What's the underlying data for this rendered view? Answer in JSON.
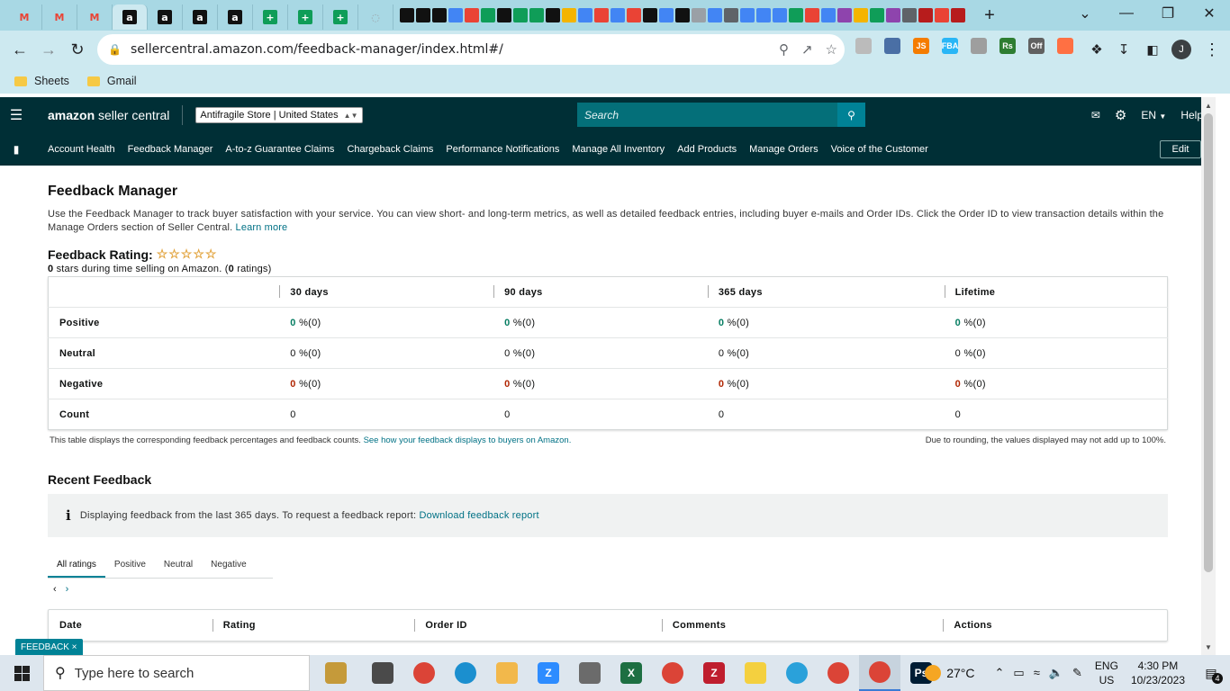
{
  "browser": {
    "tabs": [
      {
        "icon": "gmail-icon",
        "glyph": "M",
        "color": "#ea4335"
      },
      {
        "icon": "gmail-icon",
        "glyph": "M",
        "color": "#ea4335"
      },
      {
        "icon": "gmail-icon",
        "glyph": "M",
        "color": "#ea4335"
      },
      {
        "icon": "amazon-icon",
        "glyph": "a",
        "color": "#111111",
        "active": true
      },
      {
        "icon": "amazon-icon",
        "glyph": "a",
        "color": "#111111"
      },
      {
        "icon": "amazon-icon",
        "glyph": "a",
        "color": "#111111"
      },
      {
        "icon": "amazon-icon",
        "glyph": "a",
        "color": "#111111"
      },
      {
        "icon": "sheets-icon",
        "glyph": "+",
        "color": "#0f9d58"
      },
      {
        "icon": "sheets-icon",
        "glyph": "+",
        "color": "#0f9d58"
      },
      {
        "icon": "sheets-icon",
        "glyph": "+",
        "color": "#0f9d58"
      },
      {
        "icon": "loading-icon",
        "glyph": "◌",
        "color": "#9aa0a6"
      }
    ],
    "mini_tabs": [
      "#111111",
      "#111111",
      "#111111",
      "#4285f4",
      "#ea4335",
      "#0f9d58",
      "#111111",
      "#0f9d58",
      "#0f9d58",
      "#111111",
      "#f4b400",
      "#4285f4",
      "#ea4335",
      "#4285f4",
      "#ea4335",
      "#111111",
      "#4285f4",
      "#111111",
      "#9aa0a6",
      "#4285f4",
      "#5f6368",
      "#4285f4",
      "#4285f4",
      "#4285f4",
      "#0f9d58",
      "#ea4335",
      "#4285f4",
      "#8e44ad",
      "#f4b400",
      "#0f9d58",
      "#8e44ad",
      "#5f6368",
      "#b71c1c",
      "#ea4335",
      "#b71c1c"
    ],
    "new_tab": "+",
    "url": "sellercentral.amazon.com/feedback-manager/index.html#/",
    "profile_initial": "J",
    "extensions": [
      {
        "name": "extension-icon",
        "color": "#bbbbbb",
        "label": ""
      },
      {
        "name": "extension-icon",
        "color": "#4a6fa5",
        "label": ""
      },
      {
        "name": "js-extension-icon",
        "color": "#f57c00",
        "label": "JS"
      },
      {
        "name": "fba-extension-icon",
        "color": "#29b6f6",
        "label": "FBA"
      },
      {
        "name": "extension-icon",
        "color": "#9e9e9e",
        "label": ""
      },
      {
        "name": "rs-extension-icon",
        "color": "#2e7d32",
        "label": "Rs"
      },
      {
        "name": "off-extension-icon",
        "color": "#616161",
        "label": "Off"
      },
      {
        "name": "extension-icon",
        "color": "#ff7043",
        "label": ""
      }
    ],
    "bookmarks": [
      {
        "label": "Sheets"
      },
      {
        "label": "Gmail"
      }
    ]
  },
  "header": {
    "logo_strong": "amazon",
    "logo_rest": "seller central",
    "store": "Antifragile Store | United States",
    "search_placeholder": "Search",
    "language": "EN",
    "help": "Help"
  },
  "nav": {
    "items": [
      "Account Health",
      "Feedback Manager",
      "A-to-z Guarantee Claims",
      "Chargeback Claims",
      "Performance Notifications",
      "Manage All Inventory",
      "Add Products",
      "Manage Orders",
      "Voice of the Customer"
    ],
    "edit": "Edit"
  },
  "main": {
    "title": "Feedback Manager",
    "intro": "Use the Feedback Manager to track buyer satisfaction with your service. You can view short- and long-term metrics, as well as detailed feedback entries, including buyer e-mails and Order IDs. Click the Order ID to view transaction details within the Manage Orders section of Seller Central.",
    "learn_more": "Learn more",
    "rating_title": "Feedback Rating:",
    "stars": "☆☆☆☆☆",
    "rating_stars_value": 0,
    "rating_count": "0",
    "rating_sub_pre": "stars during time selling on Amazon. (",
    "rating_sub_post": "ratings)",
    "table": {
      "columns": [
        "30 days",
        "90 days",
        "365 days",
        "Lifetime"
      ],
      "rows": [
        {
          "label": "Positive",
          "tone": "green",
          "values": [
            [
              "0",
              "%(0)"
            ],
            [
              "0",
              "%(0)"
            ],
            [
              "0",
              "%(0)"
            ],
            [
              "0",
              "%(0)"
            ]
          ]
        },
        {
          "label": "Neutral",
          "tone": "neutral",
          "values": [
            [
              "0",
              "%(0)"
            ],
            [
              "0",
              "%(0)"
            ],
            [
              "0",
              "%(0)"
            ],
            [
              "0",
              "%(0)"
            ]
          ]
        },
        {
          "label": "Negative",
          "tone": "red",
          "values": [
            [
              "0",
              "%(0)"
            ],
            [
              "0",
              "%(0)"
            ],
            [
              "0",
              "%(0)"
            ],
            [
              "0",
              "%(0)"
            ]
          ]
        },
        {
          "label": "Count",
          "tone": "plain",
          "values": [
            [
              "0",
              ""
            ],
            [
              "0",
              ""
            ],
            [
              "0",
              ""
            ],
            [
              "0",
              ""
            ]
          ]
        }
      ]
    },
    "table_note": "This table displays the corresponding feedback percentages and feedback counts.",
    "table_note_link": "See how your feedback displays to buyers on Amazon.",
    "rounding_note": "Due to rounding, the values displayed may not add up to 100%.",
    "recent_title": "Recent Feedback",
    "info_icon": "i",
    "info_text": "Displaying feedback from the last 365 days. To request a feedback report:",
    "info_link": "Download feedback report",
    "filter_tabs": [
      "All ratings",
      "Positive",
      "Neutral",
      "Negative"
    ],
    "pager_prev": "‹",
    "pager_next": "›",
    "recent_columns": [
      "Date",
      "Rating",
      "Order ID",
      "Comments",
      "Actions"
    ]
  },
  "feedback_tag": "FEEDBACK ×",
  "taskbar": {
    "search_placeholder": "Type here to search",
    "apps": [
      {
        "name": "explorer-icon",
        "color": "#c59a3a",
        "glyph": "",
        "active": false
      },
      {
        "name": "task-view-icon",
        "color": "#4a4a4a",
        "glyph": "",
        "active": false
      },
      {
        "name": "chrome-icon",
        "color": "#db4437",
        "glyph": "",
        "active": false
      },
      {
        "name": "edge-icon",
        "color": "#1b8fcf",
        "glyph": "",
        "active": false
      },
      {
        "name": "file-explorer-icon",
        "color": "#f2b84b",
        "glyph": "",
        "active": false
      },
      {
        "name": "zoom-icon",
        "color": "#2d8cff",
        "glyph": "Z",
        "active": false
      },
      {
        "name": "calculator-icon",
        "color": "#6b6b6b",
        "glyph": "",
        "active": false
      },
      {
        "name": "excel-icon",
        "color": "#1d6f42",
        "glyph": "X",
        "active": false
      },
      {
        "name": "chrome-icon",
        "color": "#db4437",
        "glyph": "",
        "active": false
      },
      {
        "name": "filezilla-icon",
        "color": "#bf1e2e",
        "glyph": "Z",
        "active": false
      },
      {
        "name": "sticky-notes-icon",
        "color": "#f4d03f",
        "glyph": "",
        "active": false
      },
      {
        "name": "telegram-icon",
        "color": "#2aa1da",
        "glyph": "",
        "active": false
      },
      {
        "name": "chrome-icon",
        "color": "#db4437",
        "glyph": "",
        "active": false
      },
      {
        "name": "chrome-icon",
        "color": "#db4437",
        "glyph": "",
        "active": true
      },
      {
        "name": "photoshop-icon",
        "color": "#001d34",
        "glyph": "Ps",
        "active": false
      }
    ],
    "temperature": "27°C",
    "lang_top": "ENG",
    "lang_bottom": "US",
    "time": "4:30 PM",
    "date": "10/23/2023",
    "notifications": "4"
  }
}
